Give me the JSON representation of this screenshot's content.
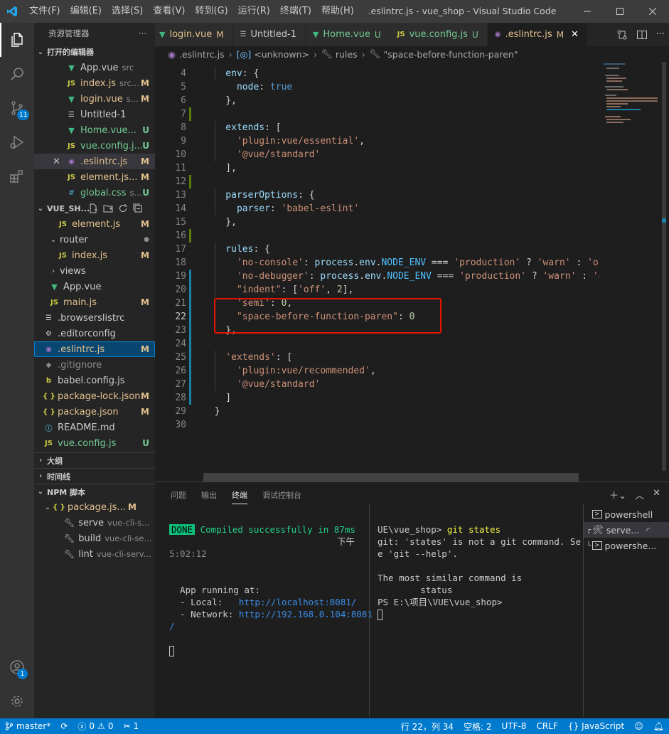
{
  "menu": [
    "文件(F)",
    "编辑(E)",
    "选择(S)",
    "查看(V)",
    "转到(G)",
    "运行(R)",
    "终端(T)",
    "帮助(H)"
  ],
  "window_title": ".eslintrc.js - vue_shop - Visual Studio Code",
  "activity": {
    "scm_badge": "11",
    "accounts_badge": "1"
  },
  "sidebar": {
    "title": "资源管理器",
    "open_editors_label": "打开的编辑器",
    "open_editors": [
      {
        "name": "App.vue",
        "desc": "src",
        "status": "",
        "icon": "vue",
        "color": "cN"
      },
      {
        "name": "index.js",
        "desc": "src...",
        "status": "M",
        "icon": "js",
        "color": "cM"
      },
      {
        "name": "login.vue",
        "desc": "s...",
        "status": "M",
        "icon": "vue",
        "color": "cM"
      },
      {
        "name": "Untitled-1",
        "desc": "",
        "status": "",
        "icon": "txt",
        "color": "cN"
      },
      {
        "name": "Home.vue...",
        "desc": "",
        "status": "U",
        "icon": "vue",
        "color": "cU"
      },
      {
        "name": "vue.config.j...",
        "desc": "",
        "status": "U",
        "icon": "js",
        "color": "cU"
      },
      {
        "name": ".eslintrc.js",
        "desc": "",
        "status": "M",
        "icon": "eslint",
        "color": "cM"
      },
      {
        "name": "element.js...",
        "desc": "",
        "status": "M",
        "icon": "js",
        "color": "cM"
      },
      {
        "name": "global.css",
        "desc": "s...",
        "status": "U",
        "icon": "css",
        "color": "cU"
      }
    ],
    "project_label": "VUE_SH...",
    "files": [
      {
        "name": "element.js",
        "status": "M",
        "icon": "js",
        "color": "cM",
        "indent": 3
      },
      {
        "name": "router",
        "status": "●",
        "icon": "",
        "color": "cN",
        "indent": 2,
        "tw": "⌄"
      },
      {
        "name": "index.js",
        "status": "M",
        "icon": "js",
        "color": "cM",
        "indent": 3
      },
      {
        "name": "views",
        "status": "",
        "icon": "",
        "color": "cN",
        "indent": 2,
        "tw": "›"
      },
      {
        "name": "App.vue",
        "status": "",
        "icon": "vue",
        "color": "cN",
        "indent": 2
      },
      {
        "name": "main.js",
        "status": "M",
        "icon": "js",
        "color": "cM",
        "indent": 2
      },
      {
        "name": ".browserslistrc",
        "status": "",
        "icon": "list",
        "color": "cN",
        "indent": 1
      },
      {
        "name": ".editorconfig",
        "status": "",
        "icon": "gear",
        "color": "cN",
        "indent": 1
      },
      {
        "name": ".eslintrc.js",
        "status": "M",
        "icon": "eslint",
        "color": "cM",
        "indent": 1
      },
      {
        "name": ".gitignore",
        "status": "",
        "icon": "git",
        "color": "cG",
        "indent": 1
      },
      {
        "name": "babel.config.js",
        "status": "",
        "icon": "babel",
        "color": "cN",
        "indent": 1
      },
      {
        "name": "package-lock.json",
        "status": "M",
        "icon": "json",
        "color": "cM",
        "indent": 1
      },
      {
        "name": "package.json",
        "status": "M",
        "icon": "json",
        "color": "cM",
        "indent": 1
      },
      {
        "name": "README.md",
        "status": "",
        "icon": "info",
        "color": "cN",
        "indent": 1
      },
      {
        "name": "vue.config.js",
        "status": "U",
        "icon": "js",
        "color": "cU",
        "indent": 1
      }
    ],
    "outline_label": "大纲",
    "timeline_label": "时间线",
    "npm_label": "NPM 脚本",
    "npm_package": "package.js...",
    "npm_package_status": "M",
    "npm_scripts": [
      {
        "name": "serve",
        "desc": "vue-cli-s..."
      },
      {
        "name": "build",
        "desc": "vue-cli-se..."
      },
      {
        "name": "lint",
        "desc": "vue-cli-serv..."
      }
    ]
  },
  "tabs": [
    {
      "name": "login.vue",
      "status": "M",
      "icon": "vue",
      "color": "cM"
    },
    {
      "name": "Untitled-1",
      "status": "",
      "icon": "txt",
      "color": "cN"
    },
    {
      "name": "Home.vue",
      "status": "U",
      "icon": "vue",
      "color": "cU"
    },
    {
      "name": "vue.config.js",
      "status": "U",
      "icon": "js",
      "color": "cU"
    },
    {
      "name": ".eslintrc.js",
      "status": "M",
      "icon": "eslint",
      "color": "cM",
      "active": true
    }
  ],
  "breadcrumb": [
    ".eslintrc.js",
    "<unknown>",
    "rules",
    "\"space-before-function-paren\""
  ],
  "code": [
    {
      "n": "4",
      "g": "",
      "t": [
        [
          "v",
          "    env"
        ],
        [
          "p",
          ": {"
        ]
      ]
    },
    {
      "n": "5",
      "g": "",
      "t": [
        [
          "v",
          "      node"
        ],
        [
          "p",
          ": "
        ],
        [
          "k",
          "true"
        ]
      ]
    },
    {
      "n": "6",
      "g": "",
      "t": [
        [
          "p",
          "    },"
        ]
      ]
    },
    {
      "n": "7",
      "g": "add",
      "t": []
    },
    {
      "n": "8",
      "g": "",
      "t": [
        [
          "v",
          "    extends"
        ],
        [
          "p",
          ": ["
        ]
      ]
    },
    {
      "n": "9",
      "g": "",
      "t": [
        [
          "s",
          "      'plugin:vue/essential'"
        ],
        [
          "p",
          ","
        ]
      ]
    },
    {
      "n": "10",
      "g": "",
      "t": [
        [
          "s",
          "      '@vue/standard'"
        ]
      ]
    },
    {
      "n": "11",
      "g": "",
      "t": [
        [
          "p",
          "    ],"
        ]
      ]
    },
    {
      "n": "12",
      "g": "add",
      "t": []
    },
    {
      "n": "13",
      "g": "",
      "t": [
        [
          "v",
          "    parserOptions"
        ],
        [
          "p",
          ": {"
        ]
      ]
    },
    {
      "n": "14",
      "g": "",
      "t": [
        [
          "v",
          "      parser"
        ],
        [
          "p",
          ": "
        ],
        [
          "s",
          "'babel-eslint'"
        ]
      ]
    },
    {
      "n": "15",
      "g": "",
      "t": [
        [
          "p",
          "    },"
        ]
      ]
    },
    {
      "n": "16",
      "g": "add",
      "t": []
    },
    {
      "n": "17",
      "g": "",
      "t": [
        [
          "v",
          "    rules"
        ],
        [
          "p",
          ": {"
        ]
      ]
    },
    {
      "n": "18",
      "g": "",
      "t": [
        [
          "s",
          "      'no-console'"
        ],
        [
          "p",
          ": "
        ],
        [
          "v",
          "process"
        ],
        [
          "p",
          "."
        ],
        [
          "v",
          "env"
        ],
        [
          "p",
          "."
        ],
        [
          "kv",
          "NODE_ENV"
        ],
        [
          "p",
          " === "
        ],
        [
          "s",
          "'production'"
        ],
        [
          "p",
          " ? "
        ],
        [
          "s",
          "'warn'"
        ],
        [
          "p",
          " : "
        ],
        [
          "s",
          "'off'"
        ],
        [
          "p",
          ","
        ]
      ]
    },
    {
      "n": "19",
      "g": "mod",
      "t": [
        [
          "s",
          "      'no-debugger'"
        ],
        [
          "p",
          ": "
        ],
        [
          "v",
          "process"
        ],
        [
          "p",
          "."
        ],
        [
          "v",
          "env"
        ],
        [
          "p",
          "."
        ],
        [
          "kv",
          "NODE_ENV"
        ],
        [
          "p",
          " === "
        ],
        [
          "s",
          "'production'"
        ],
        [
          "p",
          " ? "
        ],
        [
          "s",
          "'warn'"
        ],
        [
          "p",
          " : "
        ],
        [
          "s",
          "'off'"
        ]
      ]
    },
    {
      "n": "20",
      "g": "mod",
      "t": [
        [
          "s",
          "      \"indent\""
        ],
        [
          "p",
          ": ["
        ],
        [
          "s",
          "'off'"
        ],
        [
          "p",
          ", "
        ],
        [
          "n",
          "2"
        ],
        [
          "p",
          "],"
        ]
      ]
    },
    {
      "n": "21",
      "g": "mod",
      "t": [
        [
          "s",
          "      'semi'"
        ],
        [
          "p",
          ": "
        ],
        [
          "n",
          "0"
        ],
        [
          "p",
          ","
        ]
      ]
    },
    {
      "n": "22",
      "g": "mod",
      "cur": true,
      "t": [
        [
          "s",
          "      \"space-before-function-paren\""
        ],
        [
          "p",
          ": "
        ],
        [
          "n",
          "0"
        ]
      ]
    },
    {
      "n": "23",
      "g": "mod",
      "t": [
        [
          "p",
          "    },"
        ]
      ]
    },
    {
      "n": "24",
      "g": "mod",
      "t": []
    },
    {
      "n": "25",
      "g": "mod",
      "t": [
        [
          "s",
          "    'extends'"
        ],
        [
          "p",
          ": ["
        ]
      ]
    },
    {
      "n": "26",
      "g": "mod",
      "t": [
        [
          "s",
          "      'plugin:vue/recommended'"
        ],
        [
          "p",
          ","
        ]
      ]
    },
    {
      "n": "27",
      "g": "mod",
      "t": [
        [
          "s",
          "      '@vue/standard'"
        ]
      ]
    },
    {
      "n": "28",
      "g": "mod",
      "t": [
        [
          "p",
          "    ]"
        ]
      ]
    },
    {
      "n": "29",
      "g": "",
      "t": [
        [
          "p",
          "  }"
        ]
      ]
    },
    {
      "n": "30",
      "g": "",
      "t": []
    }
  ],
  "panel": {
    "tabs": [
      "问题",
      "输出",
      "终端",
      "调试控制台"
    ],
    "active_tab": "终端",
    "term_left": {
      "done": "DONE",
      "compiled": " Compiled successfully in 87ms",
      "ampm": "下午",
      "time": "5:02:12",
      "running": "  App running at:",
      "local_label": "  - Local:   ",
      "local_url": "http://localhost:8081/",
      "network_label": "  - Network: ",
      "network_url": "http://192.168.0.104:8081",
      "slash": "/"
    },
    "term_right": {
      "l1a": "UE\\vue_shop> ",
      "l1b": "git states",
      "l2": "git: 'states' is not a git command. Se",
      "l3": "e 'git --help'.",
      "l5": "The most similar command is",
      "l6": "        status",
      "l7": "PS E:\\项目\\VUE\\vue_shop>"
    },
    "terminals": [
      "powershell",
      "serve...",
      "powershe..."
    ]
  },
  "status": {
    "branch": "master*",
    "errors": "0",
    "warnings": "0",
    "ports": "1",
    "position": "行 22，列 34",
    "spaces": "空格: 2",
    "encoding": "UTF-8",
    "eol": "CRLF",
    "language": "JavaScript"
  }
}
